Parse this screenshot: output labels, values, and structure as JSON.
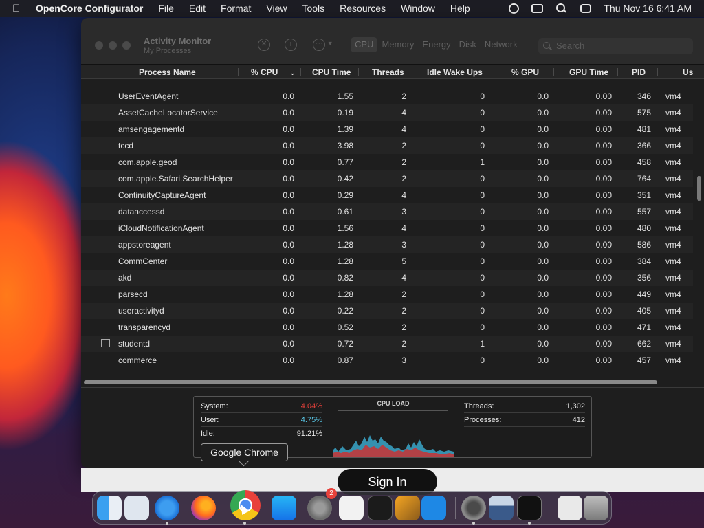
{
  "menubar": {
    "app_name": "OpenCore Configurator",
    "items": [
      "File",
      "Edit",
      "Format",
      "View",
      "Tools",
      "Resources",
      "Window",
      "Help"
    ],
    "clock": "Thu Nov 16  6:41 AM",
    "status_icons": [
      "gear-icon",
      "screen-mirroring-icon",
      "search-icon",
      "control-center-icon"
    ]
  },
  "window": {
    "title": "Activity Monitor",
    "subtitle": "My Processes",
    "tabs": [
      "CPU",
      "Memory",
      "Energy",
      "Disk",
      "Network"
    ],
    "active_tab": "CPU",
    "search_placeholder": "Search"
  },
  "columns": [
    "Process Name",
    "% CPU",
    "CPU Time",
    "Threads",
    "Idle Wake Ups",
    "% GPU",
    "GPU Time",
    "PID",
    "Us"
  ],
  "rows": [
    {
      "name": "UserEventAgent",
      "cpu": "0.0",
      "cpu_time": "1.55",
      "threads": "2",
      "idle": "0",
      "gpu": "0.0",
      "gpu_time": "0.00",
      "pid": "346",
      "user": "vm4"
    },
    {
      "name": "AssetCacheLocatorService",
      "cpu": "0.0",
      "cpu_time": "0.19",
      "threads": "4",
      "idle": "0",
      "gpu": "0.0",
      "gpu_time": "0.00",
      "pid": "575",
      "user": "vm4"
    },
    {
      "name": "amsengagementd",
      "cpu": "0.0",
      "cpu_time": "1.39",
      "threads": "4",
      "idle": "0",
      "gpu": "0.0",
      "gpu_time": "0.00",
      "pid": "481",
      "user": "vm4"
    },
    {
      "name": "tccd",
      "cpu": "0.0",
      "cpu_time": "3.98",
      "threads": "2",
      "idle": "0",
      "gpu": "0.0",
      "gpu_time": "0.00",
      "pid": "366",
      "user": "vm4"
    },
    {
      "name": "com.apple.geod",
      "cpu": "0.0",
      "cpu_time": "0.77",
      "threads": "2",
      "idle": "1",
      "gpu": "0.0",
      "gpu_time": "0.00",
      "pid": "458",
      "user": "vm4"
    },
    {
      "name": "com.apple.Safari.SearchHelper",
      "cpu": "0.0",
      "cpu_time": "0.42",
      "threads": "2",
      "idle": "0",
      "gpu": "0.0",
      "gpu_time": "0.00",
      "pid": "764",
      "user": "vm4"
    },
    {
      "name": "ContinuityCaptureAgent",
      "cpu": "0.0",
      "cpu_time": "0.29",
      "threads": "4",
      "idle": "0",
      "gpu": "0.0",
      "gpu_time": "0.00",
      "pid": "351",
      "user": "vm4"
    },
    {
      "name": "dataaccessd",
      "cpu": "0.0",
      "cpu_time": "0.61",
      "threads": "3",
      "idle": "0",
      "gpu": "0.0",
      "gpu_time": "0.00",
      "pid": "557",
      "user": "vm4"
    },
    {
      "name": "iCloudNotificationAgent",
      "cpu": "0.0",
      "cpu_time": "1.56",
      "threads": "4",
      "idle": "0",
      "gpu": "0.0",
      "gpu_time": "0.00",
      "pid": "480",
      "user": "vm4"
    },
    {
      "name": "appstoreagent",
      "cpu": "0.0",
      "cpu_time": "1.28",
      "threads": "3",
      "idle": "0",
      "gpu": "0.0",
      "gpu_time": "0.00",
      "pid": "586",
      "user": "vm4"
    },
    {
      "name": "CommCenter",
      "cpu": "0.0",
      "cpu_time": "1.28",
      "threads": "5",
      "idle": "0",
      "gpu": "0.0",
      "gpu_time": "0.00",
      "pid": "384",
      "user": "vm4"
    },
    {
      "name": "akd",
      "cpu": "0.0",
      "cpu_time": "0.82",
      "threads": "4",
      "idle": "0",
      "gpu": "0.0",
      "gpu_time": "0.00",
      "pid": "356",
      "user": "vm4"
    },
    {
      "name": "parsecd",
      "cpu": "0.0",
      "cpu_time": "1.28",
      "threads": "2",
      "idle": "0",
      "gpu": "0.0",
      "gpu_time": "0.00",
      "pid": "449",
      "user": "vm4"
    },
    {
      "name": "useractivityd",
      "cpu": "0.0",
      "cpu_time": "0.22",
      "threads": "2",
      "idle": "0",
      "gpu": "0.0",
      "gpu_time": "0.00",
      "pid": "405",
      "user": "vm4"
    },
    {
      "name": "transparencyd",
      "cpu": "0.0",
      "cpu_time": "0.52",
      "threads": "2",
      "idle": "0",
      "gpu": "0.0",
      "gpu_time": "0.00",
      "pid": "471",
      "user": "vm4"
    },
    {
      "name": "studentd",
      "cpu": "0.0",
      "cpu_time": "0.72",
      "threads": "2",
      "idle": "1",
      "gpu": "0.0",
      "gpu_time": "0.00",
      "pid": "662",
      "user": "vm4",
      "icon": "window-icon"
    },
    {
      "name": "commerce",
      "cpu": "0.0",
      "cpu_time": "0.87",
      "threads": "3",
      "idle": "0",
      "gpu": "0.0",
      "gpu_time": "0.00",
      "pid": "457",
      "user": "vm4"
    }
  ],
  "stats": {
    "system_label": "System:",
    "system_value": "4.04%",
    "user_label": "User:",
    "user_value": "4.75%",
    "idle_label": "Idle:",
    "idle_value": "91.21%",
    "cpu_load_label": "CPU LOAD",
    "threads_label": "Threads:",
    "threads_value": "1,302",
    "processes_label": "Processes:",
    "processes_value": "412",
    "colors": {
      "system": "#e8413b",
      "user": "#5ac8e8"
    }
  },
  "behind": {
    "sign_in": "Sign In"
  },
  "tooltip": "Google Chrome",
  "dock": {
    "apps": [
      "finder-icon",
      "launchpad-icon",
      "safari-icon",
      "firefox-icon",
      "chrome-icon",
      "app-store-icon",
      "system-settings-icon",
      "textedit-icon",
      "terminal-icon",
      "garageband-icon",
      "vscode-icon",
      "opencore-icon",
      "preview-icon",
      "activity-monitor-icon",
      "downloads-icon",
      "trash-icon"
    ],
    "settings_badge": "2"
  }
}
